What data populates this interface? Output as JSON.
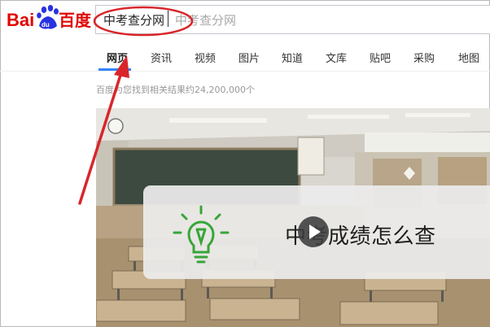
{
  "header": {
    "logo_text": "Bai百度",
    "search": {
      "value": "中考查分网",
      "suggestion": "中考查分网"
    }
  },
  "tabs": [
    {
      "label": "网页",
      "active": true
    },
    {
      "label": "资讯"
    },
    {
      "label": "视频"
    },
    {
      "label": "图片"
    },
    {
      "label": "知道"
    },
    {
      "label": "文库"
    },
    {
      "label": "贴吧"
    },
    {
      "label": "采购"
    },
    {
      "label": "地图"
    }
  ],
  "results": {
    "count_text": "百度为您找到相关结果约24,200,000个"
  },
  "video_card": {
    "title": "中考成绩怎么查",
    "play_icon": "play-icon",
    "bulb_icon": "lightbulb-pencil-icon"
  },
  "annotation": {
    "color": "#d8262b",
    "icons": [
      "highlight-ellipse",
      "pointer-arrow"
    ]
  },
  "colors": {
    "brand_red": "#e10601",
    "brand_blue": "#2932e1",
    "tab_active": "#3385ff",
    "bulb_green": "#38a538"
  }
}
